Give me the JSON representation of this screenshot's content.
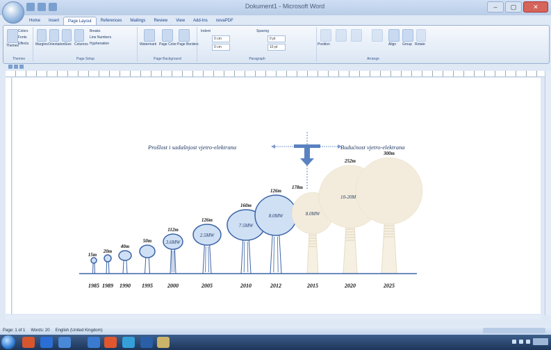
{
  "window": {
    "title": "Dokument1 - Microsoft Word",
    "quick_access": [
      "save-icon",
      "undo-icon",
      "redo-icon"
    ],
    "controls": [
      "minimize-icon",
      "maximize-icon",
      "close-icon"
    ]
  },
  "ribbon": {
    "tabs": [
      "Home",
      "Insert",
      "Page Layout",
      "References",
      "Mailings",
      "Review",
      "View",
      "Add-Ins",
      "novaPDF"
    ],
    "active_tab": "Page Layout",
    "groups": [
      {
        "label": "Themes",
        "buttons": [
          "Themes",
          "Colors",
          "Fonts",
          "Effects"
        ]
      },
      {
        "label": "Page Setup",
        "buttons": [
          "Margins",
          "Orientation",
          "Size",
          "Columns",
          "Breaks",
          "Line Numbers",
          "Hyphenation"
        ]
      },
      {
        "label": "Page Background",
        "buttons": [
          "Watermark",
          "Page Color",
          "Page Borders"
        ]
      },
      {
        "label": "Paragraph",
        "indent_label": "Indent",
        "spacing_label": "Spacing",
        "left": "0 cm",
        "right": "0 cm",
        "before": "0 pt",
        "after": "10 pt"
      },
      {
        "label": "Arrange",
        "buttons": [
          "Position",
          "Bring to Front",
          "Send to Back",
          "Text Wrapping",
          "Align",
          "Group",
          "Rotate"
        ]
      }
    ]
  },
  "diagram": {
    "left_caption": "Prošlost i sadašnjost vjetro-elektrana",
    "right_caption": "Budućnost vjetro-elektrana",
    "colors": {
      "past": "#cfe0f5",
      "past_stroke": "#3a63a6",
      "future": "#f3ecdc",
      "axis": "#3a63a6"
    },
    "turbines": [
      {
        "year": "1985",
        "height": "15m",
        "power": ""
      },
      {
        "year": "1989",
        "height": "20m",
        "power": ""
      },
      {
        "year": "1990",
        "height": "40m",
        "power": ""
      },
      {
        "year": "1995",
        "height": "50m",
        "power": ""
      },
      {
        "year": "2000",
        "height": "112m",
        "power": "3.6MW"
      },
      {
        "year": "2005",
        "height": "126m",
        "power": "2.5MW"
      },
      {
        "year": "2010",
        "height": "160m",
        "power": "7.5MW"
      },
      {
        "year": "2012",
        "height": "126m",
        "power": "8.0MW"
      },
      {
        "year": "2015",
        "height": "178m",
        "power": "8.0MW"
      },
      {
        "year": "2020",
        "height": "252m",
        "power": "10-20MW"
      },
      {
        "year": "2025",
        "height": "300m",
        "power": ""
      }
    ]
  },
  "status": {
    "page": "Page: 1 of 1",
    "words": "Words: 20",
    "language": "English (United Kingdom)"
  }
}
